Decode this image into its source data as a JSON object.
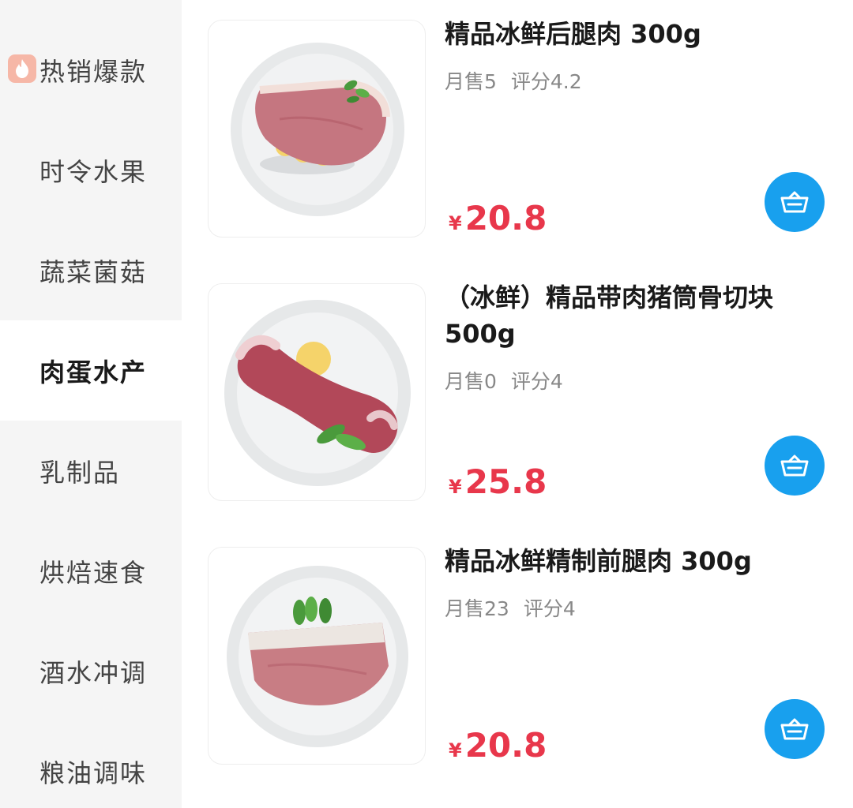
{
  "sidebar": {
    "items": [
      {
        "label": "热销爆款",
        "icon": "fire-icon"
      },
      {
        "label": "时令水果"
      },
      {
        "label": "蔬菜菌菇"
      },
      {
        "label": "肉蛋水产",
        "active": true
      },
      {
        "label": "乳制品"
      },
      {
        "label": "烘焙速食"
      },
      {
        "label": "酒水冲调"
      },
      {
        "label": "粮油调味"
      }
    ]
  },
  "products": [
    {
      "name": "精品冰鲜后腿肉 300g",
      "monthly_sales": "月售5",
      "rating": "评分4.2",
      "currency": "¥",
      "price": "20.8",
      "cart_icon": "basket-icon"
    },
    {
      "name": "（冰鲜）精品带肉猪筒骨切块 500g",
      "monthly_sales": "月售0",
      "rating": "评分4",
      "currency": "¥",
      "price": "25.8",
      "cart_icon": "basket-icon"
    },
    {
      "name": "精品冰鲜精制前腿肉 300g",
      "monthly_sales": "月售23",
      "rating": "评分4",
      "currency": "¥",
      "price": "20.8",
      "cart_icon": "basket-icon"
    }
  ],
  "colors": {
    "price": "#e8374b",
    "cart_button": "#18a0ee",
    "sidebar_bg": "#f5f5f5",
    "fire_badge": "#f6b7a7"
  }
}
